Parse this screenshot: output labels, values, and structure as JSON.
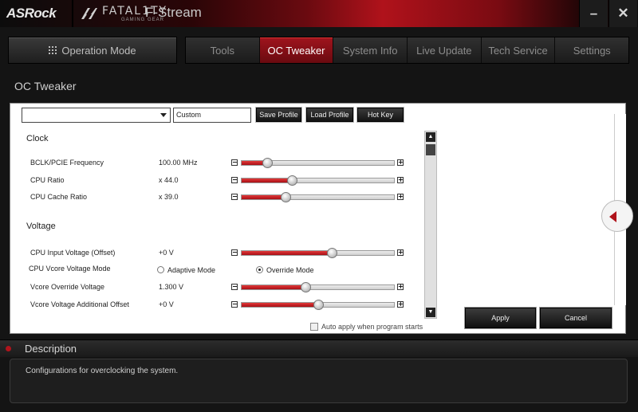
{
  "titlebar": {
    "brand": "ASRock",
    "fatality": "FATAL1TY",
    "fatality_sub": "GAMING GEAR",
    "app_title": "F-Stream",
    "minimize": "–",
    "close": "✕"
  },
  "nav": {
    "operation_mode": "Operation Mode",
    "tabs": [
      "Tools",
      "OC Tweaker",
      "System Info",
      "Live Update",
      "Tech Service",
      "Settings"
    ],
    "active": "OC Tweaker"
  },
  "page_title": "OC Tweaker",
  "toolbar": {
    "profile_select_value": "",
    "profile_name": "Custom",
    "save_profile": "Save Profile",
    "load_profile": "Load Profile",
    "hot_key": "Hot Key"
  },
  "clock": {
    "title": "Clock",
    "rows": [
      {
        "label": "BCLK/PCIE Frequency",
        "value": "100.00 MHz",
        "level": 0.17
      },
      {
        "label": "CPU Ratio",
        "value": "x 44.0",
        "level": 0.33
      },
      {
        "label": "CPU Cache Ratio",
        "value": "x 39.0",
        "level": 0.29
      }
    ]
  },
  "voltage": {
    "title": "Voltage",
    "input_voltage": {
      "label": "CPU Input Voltage (Offset)",
      "value": "+0 V",
      "level": 0.59
    },
    "vcore_mode": {
      "label": "CPU Vcore Voltage Mode",
      "options": [
        "Adaptive Mode",
        "Override Mode"
      ],
      "selected": "Override Mode"
    },
    "rows": [
      {
        "label": "Vcore Override Voltage",
        "value": "1.300 V",
        "level": 0.42
      },
      {
        "label": "Vcore Voltage Additional Offset",
        "value": "+0 V",
        "level": 0.5
      }
    ]
  },
  "auto_apply": {
    "label": "Auto apply when program starts",
    "checked": false
  },
  "actions": {
    "apply": "Apply",
    "cancel": "Cancel"
  },
  "description": {
    "title": "Description",
    "text": "Configurations for overclocking the system."
  },
  "colors": {
    "accent": "#b0141c",
    "background": "#141414",
    "panel": "#ffffff"
  }
}
